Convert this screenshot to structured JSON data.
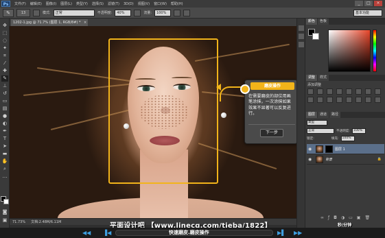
{
  "app": {
    "logo": "Ps"
  },
  "menu": [
    "文件(F)",
    "编辑(E)",
    "图像(I)",
    "图层(L)",
    "类型(Y)",
    "选择(S)",
    "滤镜(T)",
    "3D(D)",
    "视图(V)",
    "窗口(W)",
    "帮助(H)"
  ],
  "window_controls": [
    "_",
    "□",
    "×"
  ],
  "options_bar": {
    "brush_size": "13",
    "mode_label": "模式:",
    "mode_value": "正常",
    "opacity_label": "不透明度:",
    "opacity_value": "40%",
    "flow_label": "流量:",
    "flow_value": "100%",
    "workspace": "基本功能"
  },
  "document": {
    "tab_label": "1202-1.jpg @ 71.7% (图层 1, RGB/8#) *",
    "close": "×",
    "status_zoom": "71.73%",
    "status_doc": "文档:2.48M/6.11M"
  },
  "tooltip": {
    "title": "磨皮操作",
    "body": "在需要磨皮的部位用画笔涂抹，一次涂抹如果效果不显著可以反复进行。",
    "next_button": "下一步",
    "accent_color": "#f2b41a"
  },
  "panels": {
    "color_tabs": [
      "颜色",
      "色板"
    ],
    "adjust_tabs": [
      "调整",
      "样式"
    ],
    "adjust_label": "添加调整",
    "layers_tabs": [
      "图层",
      "通道",
      "路径"
    ],
    "kind_label": "类型",
    "blend_mode": "正常",
    "opacity_label": "不透明度:",
    "opacity_value": "100%",
    "lock_label": "锁定:",
    "fill_label": "填充:",
    "fill_value": "100%",
    "layers": [
      {
        "name": "图层 1",
        "selected": true
      },
      {
        "name": "背景",
        "selected": false,
        "locked": true
      }
    ]
  },
  "player": {
    "caption": "快速磨皮.磨皮操作",
    "controls": [
      "◀◀",
      "▐◀",
      "▶▌",
      "▶▶"
    ]
  },
  "watermark": {
    "text": "平面设计吧 【www.linecg.com/tieba/1822】",
    "time": "秒/分钟"
  }
}
